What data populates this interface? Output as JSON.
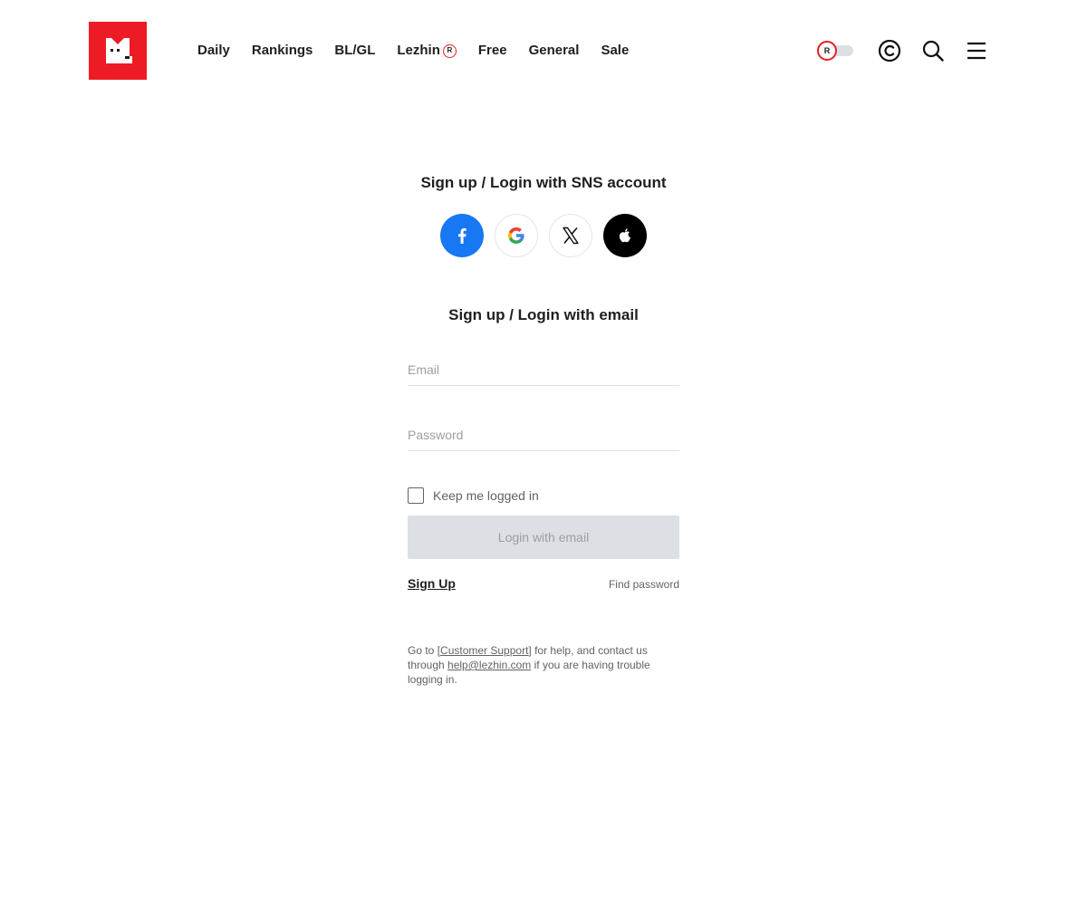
{
  "colors": {
    "brand": "#ed1c24",
    "facebook": "#1877f2",
    "apple": "#000000",
    "disabled_button": "#dcdfe3",
    "muted_text": "#5f6368"
  },
  "header": {
    "logo_icon": "lezhin-cat-logo-icon",
    "nav": [
      {
        "label": "Daily"
      },
      {
        "label": "Rankings"
      },
      {
        "label": "BL/GL"
      },
      {
        "label": "Lezhin",
        "badge": "R"
      },
      {
        "label": "Free"
      },
      {
        "label": "General"
      },
      {
        "label": "Sale"
      }
    ],
    "toggle_label": "R",
    "icons": [
      "copyright-coin-icon",
      "search-icon",
      "hamburger-menu-icon"
    ]
  },
  "login": {
    "sns_title": "Sign up / Login with SNS account",
    "sns_providers": [
      "facebook",
      "google",
      "x",
      "apple"
    ],
    "email_title": "Sign up / Login with email",
    "email_placeholder": "Email",
    "password_placeholder": "Password",
    "keep_logged_in": "Keep me logged in",
    "login_button": "Login with email",
    "signup_link": "Sign Up",
    "find_password": "Find password",
    "help": {
      "prefix": "Go to ",
      "support_link": "[Customer Support]",
      "middle": " for help, and contact us through ",
      "email_link": "help@lezhin.com",
      "suffix": " if you are having trouble logging in."
    }
  }
}
